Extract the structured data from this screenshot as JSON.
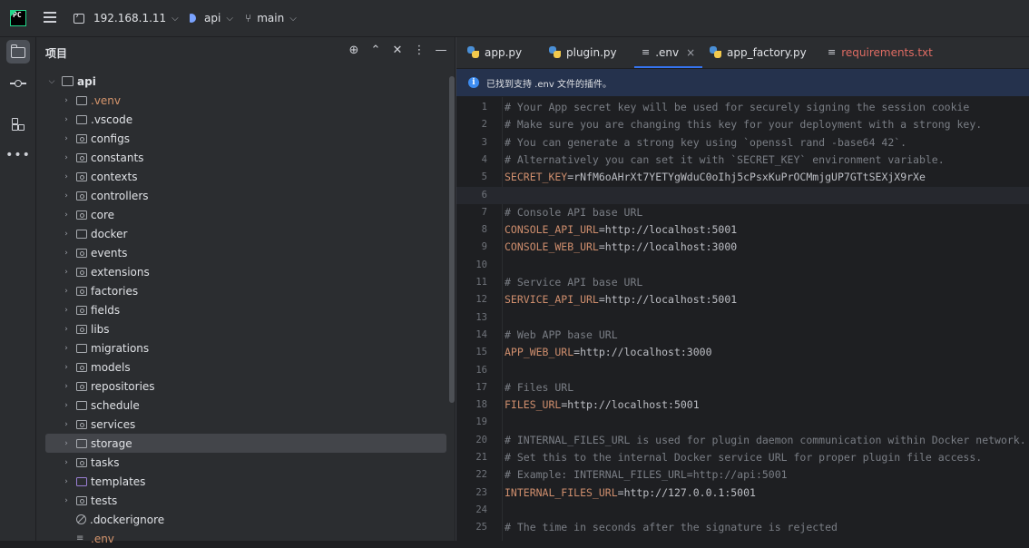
{
  "titlebar": {
    "host": "192.168.1.11",
    "project": "api",
    "branch": "main"
  },
  "project_panel": {
    "title": "项目",
    "root": "api",
    "items": [
      {
        "label": ".venv",
        "type": "folder",
        "excluded": true
      },
      {
        "label": ".vscode",
        "type": "folder"
      },
      {
        "label": "configs",
        "type": "package"
      },
      {
        "label": "constants",
        "type": "package"
      },
      {
        "label": "contexts",
        "type": "package"
      },
      {
        "label": "controllers",
        "type": "package"
      },
      {
        "label": "core",
        "type": "package"
      },
      {
        "label": "docker",
        "type": "folder"
      },
      {
        "label": "events",
        "type": "package"
      },
      {
        "label": "extensions",
        "type": "package"
      },
      {
        "label": "factories",
        "type": "package"
      },
      {
        "label": "fields",
        "type": "package"
      },
      {
        "label": "libs",
        "type": "package"
      },
      {
        "label": "migrations",
        "type": "folder"
      },
      {
        "label": "models",
        "type": "package"
      },
      {
        "label": "repositories",
        "type": "package"
      },
      {
        "label": "schedule",
        "type": "folder"
      },
      {
        "label": "services",
        "type": "package"
      },
      {
        "label": "storage",
        "type": "folder",
        "selected": true
      },
      {
        "label": "tasks",
        "type": "package"
      },
      {
        "label": "templates",
        "type": "template"
      },
      {
        "label": "tests",
        "type": "package"
      },
      {
        "label": ".dockerignore",
        "type": "ignore"
      },
      {
        "label": ".env",
        "type": "env"
      }
    ]
  },
  "tabs": [
    {
      "label": "app.py",
      "icon": "python-icon"
    },
    {
      "label": "plugin.py",
      "icon": "python-icon"
    },
    {
      "label": ".env",
      "icon": "text-file-icon",
      "active": true
    },
    {
      "label": "app_factory.py",
      "icon": "python-icon"
    },
    {
      "label": "requirements.txt",
      "icon": "text-file-icon",
      "error": true
    }
  ],
  "notice": "已找到支持 .env 文件的插件。",
  "code_lines": [
    {
      "n": "1",
      "comment": "# Your App secret key will be used for securely signing the session cookie"
    },
    {
      "n": "2",
      "comment": "# Make sure you are changing this key for your deployment with a strong key."
    },
    {
      "n": "3",
      "comment": "# You can generate a strong key using `openssl rand -base64 42`."
    },
    {
      "n": "4",
      "comment": "# Alternatively you can set it with `SECRET_KEY` environment variable."
    },
    {
      "n": "5",
      "key": "SECRET_KEY",
      "value": "rNfM6oAHrXt7YETYgWduC0oIhj5cPsxKuPrOCMmjgUP7GTtSEXjX9rXe"
    },
    {
      "n": "6",
      "current": true
    },
    {
      "n": "7",
      "comment": "# Console API base URL"
    },
    {
      "n": "8",
      "key": "CONSOLE_API_URL",
      "value": "http://localhost:5001"
    },
    {
      "n": "9",
      "key": "CONSOLE_WEB_URL",
      "value": "http://localhost:3000"
    },
    {
      "n": "10"
    },
    {
      "n": "11",
      "comment": "# Service API base URL"
    },
    {
      "n": "12",
      "key": "SERVICE_API_URL",
      "value": "http://localhost:5001"
    },
    {
      "n": "13"
    },
    {
      "n": "14",
      "comment": "# Web APP base URL"
    },
    {
      "n": "15",
      "key": "APP_WEB_URL",
      "value": "http://localhost:3000"
    },
    {
      "n": "16"
    },
    {
      "n": "17",
      "comment": "# Files URL"
    },
    {
      "n": "18",
      "key": "FILES_URL",
      "value": "http://localhost:5001"
    },
    {
      "n": "19"
    },
    {
      "n": "20",
      "comment": "# INTERNAL_FILES_URL is used for plugin daemon communication within Docker network."
    },
    {
      "n": "21",
      "comment": "# Set this to the internal Docker service URL for proper plugin file access."
    },
    {
      "n": "22",
      "comment": "# Example: INTERNAL_FILES_URL=http://api:5001"
    },
    {
      "n": "23",
      "key": "INTERNAL_FILES_URL",
      "value": "http://127.0.0.1:5001"
    },
    {
      "n": "24"
    },
    {
      "n": "25",
      "comment": "# The time in seconds after the signature is rejected"
    }
  ],
  "colors": {
    "accent": "#3574f0",
    "env_key": "#cf8e6d",
    "comment": "#7a7e85",
    "excluded": "#d5956c",
    "error_tab": "#e06c63"
  }
}
